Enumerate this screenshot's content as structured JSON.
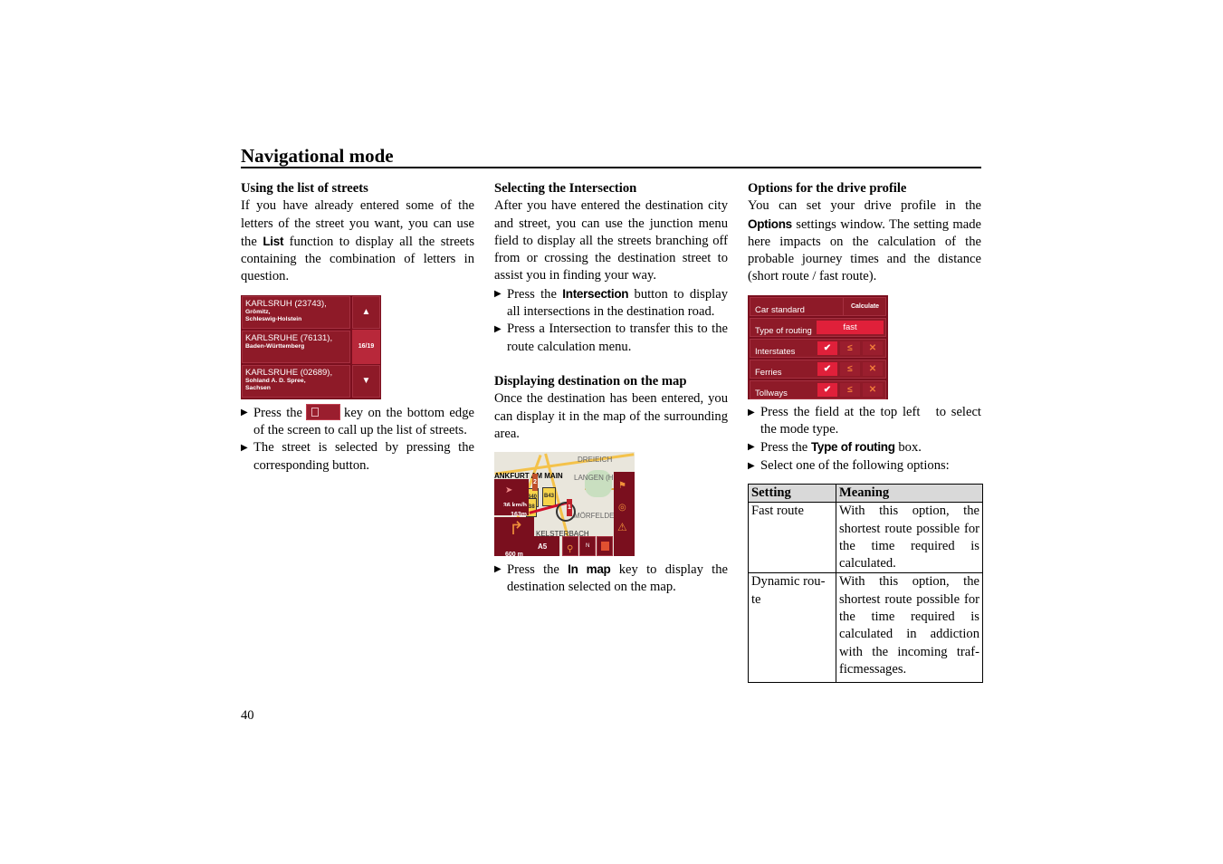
{
  "page": {
    "title": "Navigational mode",
    "page_number": "40"
  },
  "col1": {
    "heading": "Using the list of streets",
    "intro_a": "If you have already entered some of the letters of the street you want, you can use the ",
    "intro_key": "List",
    "intro_b": " function to display all the streets containing the combination of letters in question.",
    "street_list": {
      "rows": [
        {
          "name": "KARLSRUH (23743),",
          "sub1": "Grömitz,",
          "sub2": "Schleswig-Holstein"
        },
        {
          "name": "KARLSRUHE (76131),",
          "sub1": "Baden-Württemberg",
          "sub2": ""
        },
        {
          "name": "KARLSRUHE (02689),",
          "sub1": "Sohland A. D. Spree,",
          "sub2": "Sachsen"
        }
      ],
      "up_icon": "▲",
      "down_icon": "▼",
      "page_indicator": "16/19"
    },
    "bullet1_a": "Press the",
    "bullet1_b": "key on the bottom edge of the screen to call up the list of streets.",
    "bullet2": "The street is selected by pressing the corresponding button."
  },
  "col2": {
    "heading": "Selecting the Intersection",
    "para": "After you have entered the destination city and street, you can use the junction menu field to display all the streets branching off from or crossing the destination street to assist you in finding your way.",
    "bullet1_a": "Press the ",
    "bullet1_key": "Intersection",
    "bullet1_b": " button to display all intersections in the destination road.",
    "bullet2": "Press a Intersection to transfer this to the route calculation menu.",
    "heading2": "Displaying destination on the map",
    "para2": "Once the destination has been entered, you can display it in the map of the surrounding area.",
    "map": {
      "labels": [
        "DREIEICH",
        "ANKFURT AM MAIN",
        "LANGEN (HE",
        "MÖRFELDEN",
        "KELSTERBACH"
      ],
      "road_signs": [
        "B40",
        "B43",
        "B8"
      ],
      "speed": "36 km/h",
      "distance": "163m",
      "next_turn": "600 m",
      "road": "A5",
      "compass": "N",
      "markers": [
        "1",
        "2"
      ]
    },
    "bullet3_a": "Press the ",
    "bullet3_key": "In map",
    "bullet3_b": " key to display the destination selected on the map."
  },
  "col3": {
    "heading": "Options for the drive profile",
    "para_a": "You can set your drive profile in the ",
    "para_key": "Options",
    "para_b": " settings window. The setting made here impacts on the calculation of the probable journey times and the distance (short route / fast route).",
    "options_screen": {
      "profile": "Car standard",
      "calculate": "Calculate",
      "routing_label": "Type of routing",
      "routing_value": "fast",
      "rows": [
        {
          "label": "Interstates"
        },
        {
          "label": "Ferries"
        },
        {
          "label": "Tollways"
        }
      ],
      "check_icon": "✔",
      "avoid_icon": "≤",
      "cross_icon": "✕"
    },
    "bullet1": "Press the field at the top left   to select the mode type.",
    "bullet2_a": "Press the ",
    "bullet2_key": "Type of routing",
    "bullet2_b": " box.",
    "bullet3": "Select one of the following options:",
    "table": {
      "headers": [
        "Setting",
        "Meaning"
      ],
      "rows": [
        [
          "Fast route",
          "With this option, the shortest route possible for the time required is calculated."
        ],
        [
          "Dynamic rou-te",
          "With this option, the shortest route possible for the time required is calculated in addiction with the incoming traf-ficmessages."
        ]
      ]
    }
  },
  "colors": {
    "screen_bg": "#7a0f1e",
    "screen_button": "#8e1a28",
    "screen_highlight": "#e0203a"
  }
}
